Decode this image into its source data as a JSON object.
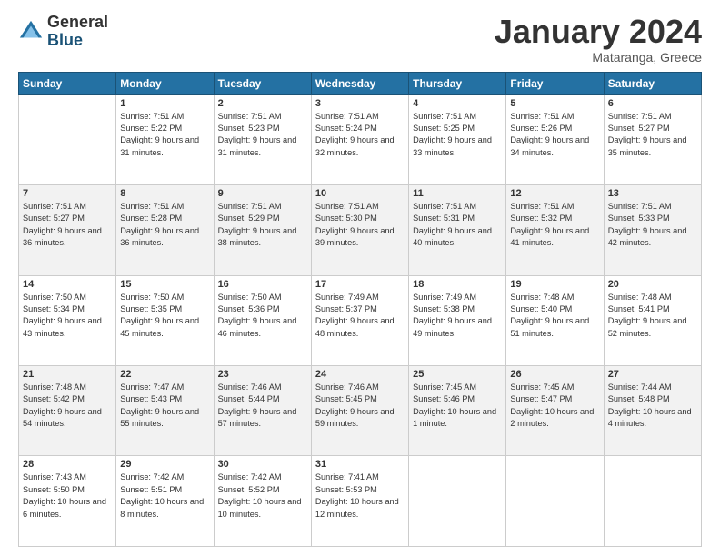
{
  "logo": {
    "general": "General",
    "blue": "Blue"
  },
  "header": {
    "month": "January 2024",
    "location": "Mataranga, Greece"
  },
  "days_of_week": [
    "Sunday",
    "Monday",
    "Tuesday",
    "Wednesday",
    "Thursday",
    "Friday",
    "Saturday"
  ],
  "weeks": [
    [
      {
        "day": "",
        "sunrise": "",
        "sunset": "",
        "daylight": ""
      },
      {
        "day": "1",
        "sunrise": "Sunrise: 7:51 AM",
        "sunset": "Sunset: 5:22 PM",
        "daylight": "Daylight: 9 hours and 31 minutes."
      },
      {
        "day": "2",
        "sunrise": "Sunrise: 7:51 AM",
        "sunset": "Sunset: 5:23 PM",
        "daylight": "Daylight: 9 hours and 31 minutes."
      },
      {
        "day": "3",
        "sunrise": "Sunrise: 7:51 AM",
        "sunset": "Sunset: 5:24 PM",
        "daylight": "Daylight: 9 hours and 32 minutes."
      },
      {
        "day": "4",
        "sunrise": "Sunrise: 7:51 AM",
        "sunset": "Sunset: 5:25 PM",
        "daylight": "Daylight: 9 hours and 33 minutes."
      },
      {
        "day": "5",
        "sunrise": "Sunrise: 7:51 AM",
        "sunset": "Sunset: 5:26 PM",
        "daylight": "Daylight: 9 hours and 34 minutes."
      },
      {
        "day": "6",
        "sunrise": "Sunrise: 7:51 AM",
        "sunset": "Sunset: 5:27 PM",
        "daylight": "Daylight: 9 hours and 35 minutes."
      }
    ],
    [
      {
        "day": "7",
        "sunrise": "Sunrise: 7:51 AM",
        "sunset": "Sunset: 5:27 PM",
        "daylight": "Daylight: 9 hours and 36 minutes."
      },
      {
        "day": "8",
        "sunrise": "Sunrise: 7:51 AM",
        "sunset": "Sunset: 5:28 PM",
        "daylight": "Daylight: 9 hours and 36 minutes."
      },
      {
        "day": "9",
        "sunrise": "Sunrise: 7:51 AM",
        "sunset": "Sunset: 5:29 PM",
        "daylight": "Daylight: 9 hours and 38 minutes."
      },
      {
        "day": "10",
        "sunrise": "Sunrise: 7:51 AM",
        "sunset": "Sunset: 5:30 PM",
        "daylight": "Daylight: 9 hours and 39 minutes."
      },
      {
        "day": "11",
        "sunrise": "Sunrise: 7:51 AM",
        "sunset": "Sunset: 5:31 PM",
        "daylight": "Daylight: 9 hours and 40 minutes."
      },
      {
        "day": "12",
        "sunrise": "Sunrise: 7:51 AM",
        "sunset": "Sunset: 5:32 PM",
        "daylight": "Daylight: 9 hours and 41 minutes."
      },
      {
        "day": "13",
        "sunrise": "Sunrise: 7:51 AM",
        "sunset": "Sunset: 5:33 PM",
        "daylight": "Daylight: 9 hours and 42 minutes."
      }
    ],
    [
      {
        "day": "14",
        "sunrise": "Sunrise: 7:50 AM",
        "sunset": "Sunset: 5:34 PM",
        "daylight": "Daylight: 9 hours and 43 minutes."
      },
      {
        "day": "15",
        "sunrise": "Sunrise: 7:50 AM",
        "sunset": "Sunset: 5:35 PM",
        "daylight": "Daylight: 9 hours and 45 minutes."
      },
      {
        "day": "16",
        "sunrise": "Sunrise: 7:50 AM",
        "sunset": "Sunset: 5:36 PM",
        "daylight": "Daylight: 9 hours and 46 minutes."
      },
      {
        "day": "17",
        "sunrise": "Sunrise: 7:49 AM",
        "sunset": "Sunset: 5:37 PM",
        "daylight": "Daylight: 9 hours and 48 minutes."
      },
      {
        "day": "18",
        "sunrise": "Sunrise: 7:49 AM",
        "sunset": "Sunset: 5:38 PM",
        "daylight": "Daylight: 9 hours and 49 minutes."
      },
      {
        "day": "19",
        "sunrise": "Sunrise: 7:48 AM",
        "sunset": "Sunset: 5:40 PM",
        "daylight": "Daylight: 9 hours and 51 minutes."
      },
      {
        "day": "20",
        "sunrise": "Sunrise: 7:48 AM",
        "sunset": "Sunset: 5:41 PM",
        "daylight": "Daylight: 9 hours and 52 minutes."
      }
    ],
    [
      {
        "day": "21",
        "sunrise": "Sunrise: 7:48 AM",
        "sunset": "Sunset: 5:42 PM",
        "daylight": "Daylight: 9 hours and 54 minutes."
      },
      {
        "day": "22",
        "sunrise": "Sunrise: 7:47 AM",
        "sunset": "Sunset: 5:43 PM",
        "daylight": "Daylight: 9 hours and 55 minutes."
      },
      {
        "day": "23",
        "sunrise": "Sunrise: 7:46 AM",
        "sunset": "Sunset: 5:44 PM",
        "daylight": "Daylight: 9 hours and 57 minutes."
      },
      {
        "day": "24",
        "sunrise": "Sunrise: 7:46 AM",
        "sunset": "Sunset: 5:45 PM",
        "daylight": "Daylight: 9 hours and 59 minutes."
      },
      {
        "day": "25",
        "sunrise": "Sunrise: 7:45 AM",
        "sunset": "Sunset: 5:46 PM",
        "daylight": "Daylight: 10 hours and 1 minute."
      },
      {
        "day": "26",
        "sunrise": "Sunrise: 7:45 AM",
        "sunset": "Sunset: 5:47 PM",
        "daylight": "Daylight: 10 hours and 2 minutes."
      },
      {
        "day": "27",
        "sunrise": "Sunrise: 7:44 AM",
        "sunset": "Sunset: 5:48 PM",
        "daylight": "Daylight: 10 hours and 4 minutes."
      }
    ],
    [
      {
        "day": "28",
        "sunrise": "Sunrise: 7:43 AM",
        "sunset": "Sunset: 5:50 PM",
        "daylight": "Daylight: 10 hours and 6 minutes."
      },
      {
        "day": "29",
        "sunrise": "Sunrise: 7:42 AM",
        "sunset": "Sunset: 5:51 PM",
        "daylight": "Daylight: 10 hours and 8 minutes."
      },
      {
        "day": "30",
        "sunrise": "Sunrise: 7:42 AM",
        "sunset": "Sunset: 5:52 PM",
        "daylight": "Daylight: 10 hours and 10 minutes."
      },
      {
        "day": "31",
        "sunrise": "Sunrise: 7:41 AM",
        "sunset": "Sunset: 5:53 PM",
        "daylight": "Daylight: 10 hours and 12 minutes."
      },
      {
        "day": "",
        "sunrise": "",
        "sunset": "",
        "daylight": ""
      },
      {
        "day": "",
        "sunrise": "",
        "sunset": "",
        "daylight": ""
      },
      {
        "day": "",
        "sunrise": "",
        "sunset": "",
        "daylight": ""
      }
    ]
  ]
}
